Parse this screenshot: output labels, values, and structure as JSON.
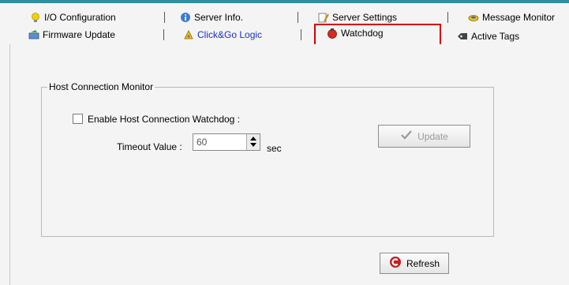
{
  "tabs_row1": [
    {
      "label": "I/O Configuration",
      "icon": "lightbulb-icon"
    },
    {
      "label": "Server Info.",
      "icon": "info-icon"
    },
    {
      "label": "Server Settings",
      "icon": "settings-icon"
    },
    {
      "label": "Message Monitor",
      "icon": "monitor-icon"
    }
  ],
  "tabs_row2": [
    {
      "label": "Firmware Update",
      "icon": "firmware-icon"
    },
    {
      "label": "Click&Go Logic",
      "icon": "logic-icon"
    },
    {
      "label": "Watchdog",
      "icon": "watchdog-icon",
      "selected": true
    },
    {
      "label": "Active Tags",
      "icon": "tags-icon"
    }
  ],
  "group": {
    "title": "Host Connection Monitor"
  },
  "watchdog": {
    "enable_label": "Enable Host Connection Watchdog :",
    "enabled": false,
    "timeout_label": "Timeout Value :",
    "timeout_value": "60",
    "unit": "sec"
  },
  "buttons": {
    "update": "Update",
    "refresh": "Refresh"
  },
  "colors": {
    "highlight": "#d80000",
    "link": "#1a2fd0",
    "accent": "#2f8fa0"
  }
}
